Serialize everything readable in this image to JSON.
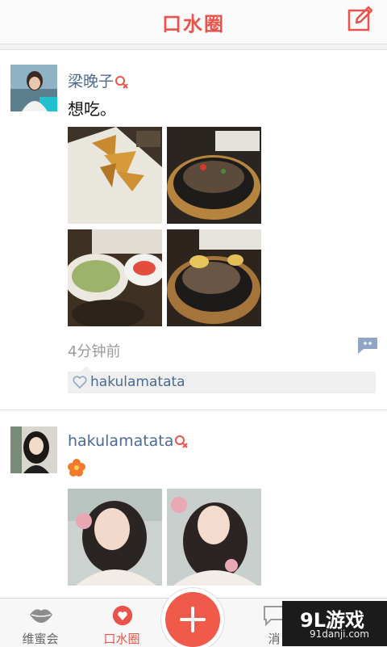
{
  "header": {
    "title": "口水圈",
    "edit_icon": "edit-icon"
  },
  "posts": [
    {
      "user": "梁晚子",
      "gender_icon": "female-icon",
      "text": "想吃。",
      "time": "4分钟前",
      "likes": [
        "hakulamatata"
      ],
      "photos": [
        "samosa-plate-photo",
        "sizzling-steak-photo",
        "salad-bowl-photo",
        "steak-pasta-photo"
      ]
    },
    {
      "user": "hakulamatata",
      "gender_icon": "female-icon",
      "text_icon": "flower-emoji-icon",
      "photos": [
        "selfie-photo-1",
        "selfie-photo-2"
      ]
    }
  ],
  "tabbar": {
    "tabs": [
      {
        "label": "维蜜会",
        "icon": "lips-icon"
      },
      {
        "label": "口水圈",
        "icon": "heart-drop-icon",
        "active": true
      },
      {
        "label": "消",
        "icon": "message-icon"
      }
    ],
    "add_icon": "plus-icon"
  },
  "watermark": {
    "brand": "9L游戏",
    "url": "91danji.com"
  },
  "colors": {
    "accent": "#e8534b",
    "name": "#4d6a93",
    "time": "#9a9a9a"
  }
}
